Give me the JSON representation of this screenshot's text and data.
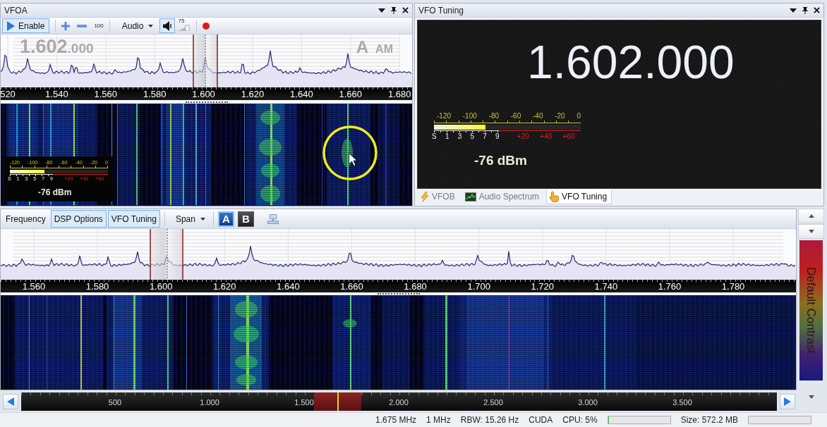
{
  "vfoa": {
    "title": "VFOA",
    "toolbar": {
      "enable": {
        "label": "Enable",
        "selected": true
      },
      "step": "100",
      "audio": "Audio",
      "speaker": {
        "selected": true
      },
      "volume": "75"
    },
    "spectrum": {
      "frequency": "1.602",
      "frequency_fraction": ".000",
      "vfo": "A",
      "mode": "AM",
      "scale": [
        "520",
        "1.540",
        "1.560",
        "1.580",
        "1.600",
        "1.620",
        "1.640",
        "1.660",
        "1.680"
      ]
    },
    "meter": {
      "db_labels": [
        "-120",
        "-100",
        "-80",
        "-60",
        "-40",
        "-20",
        "0"
      ],
      "s_labels": [
        "S",
        "1",
        "3",
        "5",
        "7",
        "9"
      ],
      "over_labels": [
        "+20",
        "+40",
        "+60"
      ],
      "level": 0.35,
      "reading": "-76 dBm"
    }
  },
  "vfo_tuning": {
    "title": "VFO Tuning",
    "frequency": "1.602.000",
    "meter": {
      "db_labels": [
        "-120",
        "-100",
        "-80",
        "-60",
        "-40",
        "-20",
        "0"
      ],
      "s_labels": [
        "S",
        "1",
        "3",
        "5",
        "7",
        "9"
      ],
      "over_labels": [
        "+20",
        "+40",
        "+60"
      ],
      "level": 0.35,
      "reading": "-76 dBm"
    },
    "tabs": [
      {
        "label": "VFOB",
        "selected": false
      },
      {
        "label": "Audio Spectrum",
        "selected": false
      },
      {
        "label": "VFO Tuning",
        "selected": true
      }
    ]
  },
  "main": {
    "toolbar": {
      "toggles": [
        {
          "label": "Frequency",
          "checked": false
        },
        {
          "label": "DSP Options",
          "checked": true
        },
        {
          "label": "VFO Tuning",
          "checked": true
        }
      ],
      "span": "Span",
      "vfo_buttons": [
        {
          "label": "A",
          "selected": true
        },
        {
          "label": "B",
          "selected": false
        }
      ]
    },
    "spectrum": {
      "scale": [
        "1.560",
        "1.580",
        "1.600",
        "1.620",
        "1.640",
        "1.660",
        "1.680",
        "1.700",
        "1.720",
        "1.740",
        "1.760",
        "1.780"
      ]
    },
    "overview": {
      "scale": [
        "500",
        "1.000",
        "1.500",
        "2.000",
        "2.500",
        "3.000",
        "3.500"
      ]
    },
    "contrast": "Default Contrast"
  },
  "status_bar": [
    {
      "kind": "text",
      "text": "1.675 MHz"
    },
    {
      "kind": "text",
      "text": "1 MHz"
    },
    {
      "kind": "text",
      "text": "RBW: 15.26 Hz"
    },
    {
      "kind": "text",
      "text": "CUDA"
    },
    {
      "kind": "text",
      "text": "CPU: 5%"
    },
    {
      "kind": "meter",
      "level": 0.02
    },
    {
      "kind": "text",
      "text": "Size: 572.2 MB"
    },
    {
      "kind": "meter"
    }
  ]
}
